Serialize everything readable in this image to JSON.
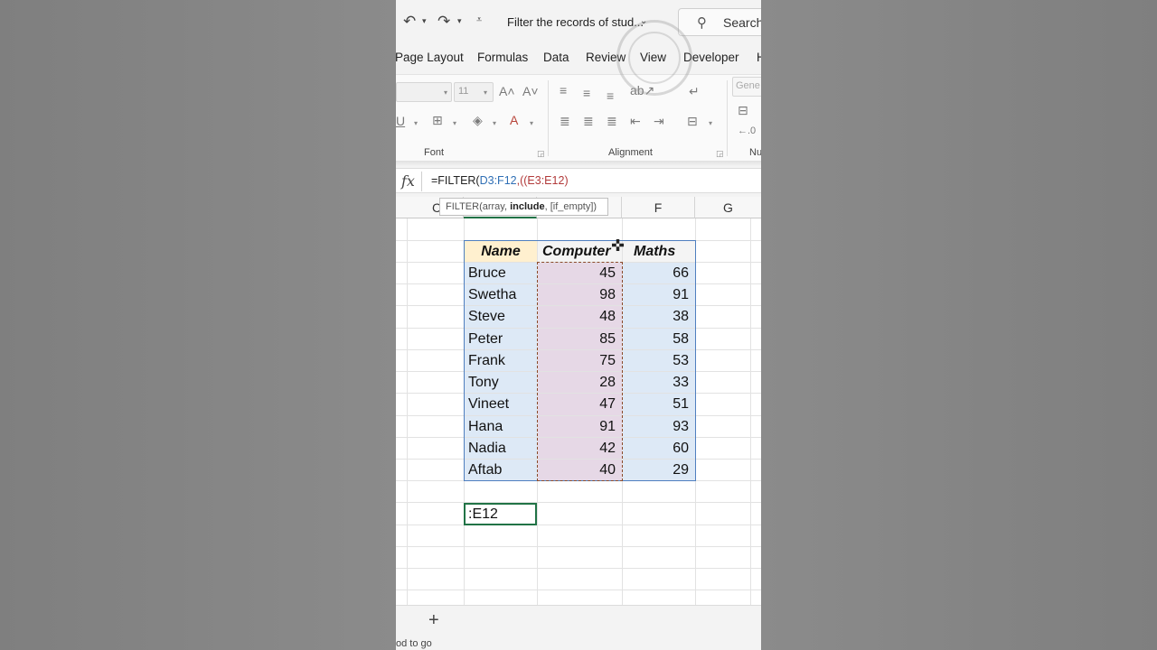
{
  "titlebar": {
    "undo_icon": "undo-icon",
    "redo_icon": "redo-icon",
    "doc_title": "Filter the records of stud...",
    "search_label": "Search"
  },
  "tabs": [
    "Page Layout",
    "Formulas",
    "Data",
    "Review",
    "View",
    "Developer",
    "H"
  ],
  "ribbon": {
    "font_size": "11",
    "font_group": "Font",
    "alignment_group": "Alignment",
    "number_format": "Gene",
    "number_group": "Nu",
    "underline": "U"
  },
  "formula_bar": {
    "fx": "fx",
    "prefix": "=FILTER(",
    "ref1": "D3:F12",
    "sep": ",((",
    "ref2": "E3:E12",
    "suffix": ")"
  },
  "tooltip": {
    "start": "FILTER(array, ",
    "bold": "include",
    "end": ", [if_empty])"
  },
  "columns": [
    "C",
    "F",
    "G"
  ],
  "table": {
    "headers": [
      "Name",
      "Computer",
      "Maths"
    ],
    "rows": [
      [
        "Bruce",
        "45",
        "66"
      ],
      [
        "Swetha",
        "98",
        "91"
      ],
      [
        "Steve",
        "48",
        "38"
      ],
      [
        "Peter",
        "85",
        "58"
      ],
      [
        "Frank",
        "75",
        "53"
      ],
      [
        "Tony",
        "28",
        "33"
      ],
      [
        "Vineet",
        "47",
        "51"
      ],
      [
        "Hana",
        "91",
        "93"
      ],
      [
        "Nadia",
        "42",
        "60"
      ],
      [
        "Aftab",
        "40",
        "29"
      ]
    ]
  },
  "active_cell_text": ":E12",
  "sheetbar": {
    "add_label": "+"
  },
  "status": "od to go",
  "colors": {
    "accent": "#217346",
    "marquee": "#8a4a2a",
    "table_border": "#4f7fbf"
  }
}
